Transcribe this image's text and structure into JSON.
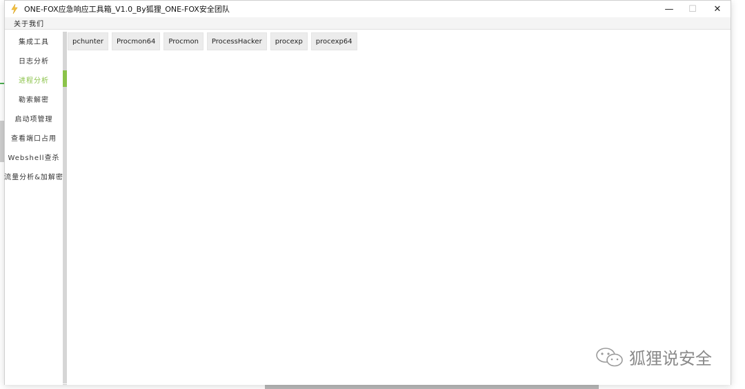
{
  "window": {
    "title": "ONE-FOX应急响应工具箱_V1.0_By狐狸_ONE-FOX安全团队",
    "minimize_symbol": "—",
    "maximize_symbol": "☐",
    "close_symbol": "✕"
  },
  "menu": {
    "about": "关于我们"
  },
  "sidebar": {
    "items": [
      {
        "label": "集成工具"
      },
      {
        "label": "日志分析"
      },
      {
        "label": "进程分析"
      },
      {
        "label": "勒索解密"
      },
      {
        "label": "启动项管理"
      },
      {
        "label": "查看端口占用"
      },
      {
        "label": "Webshell查杀"
      },
      {
        "label": "流量分析&加解密"
      }
    ],
    "active_index": 2
  },
  "tools": {
    "buttons": [
      {
        "label": "pchunter"
      },
      {
        "label": "Procmon64"
      },
      {
        "label": "Procmon"
      },
      {
        "label": "ProcessHacker"
      },
      {
        "label": "procexp"
      },
      {
        "label": "procexp64"
      }
    ]
  },
  "watermark": {
    "text": "狐狸说安全"
  },
  "colors": {
    "accent": "#8bc34a",
    "button_bg": "#ececec"
  }
}
